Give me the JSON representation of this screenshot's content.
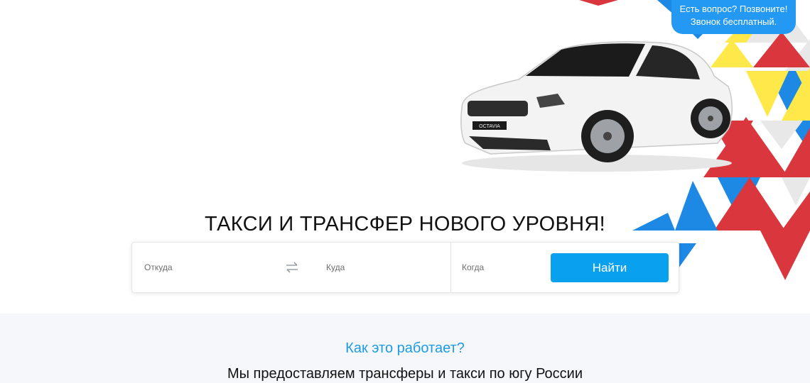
{
  "callout": {
    "line1": "Есть вопрос? Позвоните!",
    "line2": "Звонок бесплатный."
  },
  "hero": {
    "headline": "ТАКСИ И ТРАНСФЕР НОВОГО УРОВНЯ!",
    "car_plate": "OCTAVIA"
  },
  "search": {
    "from_placeholder": "Откуда",
    "to_placeholder": "Куда",
    "when_placeholder": "Когда",
    "submit_label": "Найти",
    "swap_icon": "swap-arrows-icon"
  },
  "how_it_works": {
    "title": "Как это работает?",
    "subtitle": "Мы предоставляем трансферы и такси по югу России"
  },
  "colors": {
    "accent": "#0aa0f0",
    "callout_bg": "#2399f3",
    "title_blue": "#1e9be6",
    "tri_red": "#d9373d",
    "tri_blue": "#1e88e5",
    "tri_yellow": "#ffe94a"
  }
}
